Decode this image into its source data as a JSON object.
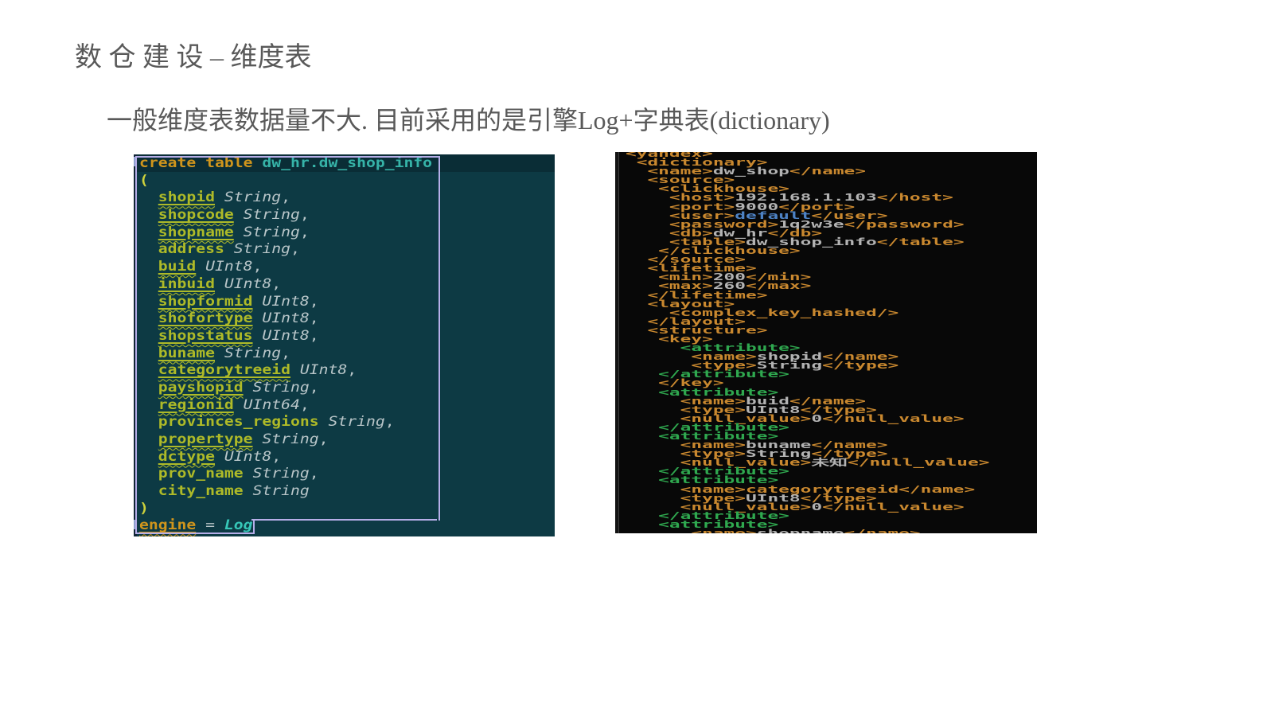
{
  "slide": {
    "title": "数 仓 建 设 – 维度表",
    "subtitle": "一般维度表数据量不大. 目前采用的是引擎Log+字典表(dictionary)"
  },
  "colors": {
    "slide_text": "#595959",
    "left_bg": "#0d3a44",
    "left_line1_bg": "#0a2d36",
    "left_gutter": "#122536",
    "sel": "#b6aee8",
    "kw_orange": "#d0951c",
    "tbl_teal": "#36b3a8",
    "paren_yellow": "#ccd13c",
    "col_green": "#aeba28",
    "type_gray": "#b9c6c9",
    "log_cyan": "#36c7b8",
    "right_bg": "#080808",
    "tag_orange": "#c9882f",
    "attr_green": "#2fa84f",
    "val_gray": "#b3b3b3",
    "user_blue": "#4d82c4",
    "right_gutter_line": "#3c3c3c"
  },
  "left_editor": {
    "lines": [
      [
        [
          "kw",
          "create table "
        ],
        [
          "tbl",
          "dw_hr.dw_shop_info"
        ]
      ],
      [
        [
          "par",
          "("
        ]
      ],
      [
        [
          "pln",
          "  "
        ],
        [
          "colw",
          "shopid"
        ],
        [
          "typ",
          " String"
        ],
        [
          "pln",
          ","
        ]
      ],
      [
        [
          "pln",
          "  "
        ],
        [
          "colw",
          "shopcode"
        ],
        [
          "typ",
          " String"
        ],
        [
          "pln",
          ","
        ]
      ],
      [
        [
          "pln",
          "  "
        ],
        [
          "colw",
          "shopname"
        ],
        [
          "typ",
          " String"
        ],
        [
          "pln",
          ","
        ]
      ],
      [
        [
          "pln",
          "  "
        ],
        [
          "col",
          "address"
        ],
        [
          "typ",
          " String"
        ],
        [
          "pln",
          ","
        ]
      ],
      [
        [
          "pln",
          "  "
        ],
        [
          "colw",
          "buid"
        ],
        [
          "typ",
          " UInt8"
        ],
        [
          "pln",
          ","
        ]
      ],
      [
        [
          "pln",
          "  "
        ],
        [
          "colw",
          "inbuid"
        ],
        [
          "typ",
          " UInt8"
        ],
        [
          "pln",
          ","
        ]
      ],
      [
        [
          "pln",
          "  "
        ],
        [
          "colw",
          "shopformid"
        ],
        [
          "typ",
          " UInt8"
        ],
        [
          "pln",
          ","
        ]
      ],
      [
        [
          "pln",
          "  "
        ],
        [
          "colw",
          "shofortype"
        ],
        [
          "typ",
          " UInt8"
        ],
        [
          "pln",
          ","
        ]
      ],
      [
        [
          "pln",
          "  "
        ],
        [
          "colw",
          "shopstatus"
        ],
        [
          "typ",
          " UInt8"
        ],
        [
          "pln",
          ","
        ]
      ],
      [
        [
          "pln",
          "  "
        ],
        [
          "colw",
          "buname"
        ],
        [
          "typ",
          " String"
        ],
        [
          "pln",
          ","
        ]
      ],
      [
        [
          "pln",
          "  "
        ],
        [
          "colw",
          "categorytreeid"
        ],
        [
          "typ",
          " UInt8"
        ],
        [
          "pln",
          ","
        ]
      ],
      [
        [
          "pln",
          "  "
        ],
        [
          "colw",
          "payshopid"
        ],
        [
          "typ",
          " String"
        ],
        [
          "pln",
          ","
        ]
      ],
      [
        [
          "pln",
          "  "
        ],
        [
          "colw",
          "regionid"
        ],
        [
          "typ",
          " UInt64"
        ],
        [
          "pln",
          ","
        ]
      ],
      [
        [
          "pln",
          "  "
        ],
        [
          "col",
          "provinces_regions"
        ],
        [
          "typ",
          " String"
        ],
        [
          "pln",
          ","
        ]
      ],
      [
        [
          "pln",
          "  "
        ],
        [
          "colw",
          "propertype"
        ],
        [
          "typ",
          " String"
        ],
        [
          "pln",
          ","
        ]
      ],
      [
        [
          "pln",
          "  "
        ],
        [
          "colw",
          "dctype"
        ],
        [
          "typ",
          " UInt8"
        ],
        [
          "pln",
          ","
        ]
      ],
      [
        [
          "pln",
          "  "
        ],
        [
          "col",
          "prov_name"
        ],
        [
          "typ",
          " String"
        ],
        [
          "pln",
          ","
        ]
      ],
      [
        [
          "pln",
          "  "
        ],
        [
          "col",
          "city_name"
        ],
        [
          "typ",
          " String"
        ]
      ],
      [
        [
          "par",
          ")"
        ]
      ],
      [
        [
          "kww",
          "engine"
        ],
        [
          "pln",
          " "
        ],
        [
          "pln",
          "="
        ],
        [
          "pln",
          " "
        ],
        [
          "log",
          "Log"
        ]
      ]
    ]
  },
  "right_editor": {
    "lines": [
      [
        [
          "tag",
          "<yandex>"
        ]
      ],
      [
        [
          "tag",
          " <dictionary>"
        ]
      ],
      [
        [
          "tag",
          "  <name>"
        ],
        [
          "val",
          "dw_shop"
        ],
        [
          "tag",
          "</name>"
        ]
      ],
      [
        [
          "tag",
          "  <source>"
        ]
      ],
      [
        [
          "tag",
          "   <clickhouse>"
        ]
      ],
      [
        [
          "tag",
          "    <host>"
        ],
        [
          "val",
          "192.168.1.103"
        ],
        [
          "tag",
          "</host>"
        ]
      ],
      [
        [
          "tag",
          "    <port>"
        ],
        [
          "val",
          "9000"
        ],
        [
          "tag",
          "</port>"
        ]
      ],
      [
        [
          "tag",
          "    <user>"
        ],
        [
          "blue",
          "default"
        ],
        [
          "tag",
          "</user>"
        ]
      ],
      [
        [
          "tag",
          "    <password>"
        ],
        [
          "val",
          "1q2w3e"
        ],
        [
          "tag",
          "</password>"
        ]
      ],
      [
        [
          "tag",
          "    <db>"
        ],
        [
          "val",
          "dw_hr"
        ],
        [
          "tag",
          "</db>"
        ]
      ],
      [
        [
          "tag",
          "    <table>"
        ],
        [
          "val",
          "dw_shop_info"
        ],
        [
          "tag",
          "</table>"
        ]
      ],
      [
        [
          "tag",
          "   </clickhouse>"
        ]
      ],
      [
        [
          "tag",
          "  </source>"
        ]
      ],
      [
        [
          "tag",
          "  <lifetime>"
        ]
      ],
      [
        [
          "tag",
          "   <min>"
        ],
        [
          "val",
          "200"
        ],
        [
          "tag",
          "</min>"
        ]
      ],
      [
        [
          "tag",
          "   <max>"
        ],
        [
          "val",
          "260"
        ],
        [
          "tag",
          "</max>"
        ]
      ],
      [
        [
          "tag",
          "  </lifetime>"
        ]
      ],
      [
        [
          "tag",
          "  <layout>"
        ]
      ],
      [
        [
          "tag",
          "    <complex_key_hashed/>"
        ]
      ],
      [
        [
          "tag",
          "  </layout>"
        ]
      ],
      [
        [
          "tag",
          "  <structure>"
        ]
      ],
      [
        [
          "tag",
          "   <key>"
        ]
      ],
      [
        [
          "gtag",
          "     <attribute>"
        ]
      ],
      [
        [
          "tag",
          "      <name>"
        ],
        [
          "val",
          "shopid"
        ],
        [
          "tag",
          "</name>"
        ]
      ],
      [
        [
          "tag",
          "      <type>"
        ],
        [
          "val",
          "String"
        ],
        [
          "tag",
          "</type>"
        ]
      ],
      [
        [
          "gtag",
          "   </attribute>"
        ]
      ],
      [
        [
          "tag",
          "   </key>"
        ]
      ],
      [
        [
          "gtag",
          "   <attribute>"
        ]
      ],
      [
        [
          "tag",
          "     <name>"
        ],
        [
          "val",
          "buid"
        ],
        [
          "tag",
          "</name>"
        ]
      ],
      [
        [
          "tag",
          "     <type>"
        ],
        [
          "val",
          "UInt8"
        ],
        [
          "tag",
          "</type>"
        ]
      ],
      [
        [
          "tag",
          "     <null_value>"
        ],
        [
          "val",
          "0"
        ],
        [
          "tag",
          "</null_value>"
        ]
      ],
      [
        [
          "gtag",
          "   </attribute>"
        ]
      ],
      [
        [
          "gtag",
          "   <attribute>"
        ]
      ],
      [
        [
          "tag",
          "     <name>"
        ],
        [
          "val",
          "buname"
        ],
        [
          "tag",
          "</name>"
        ]
      ],
      [
        [
          "tag",
          "     <type>"
        ],
        [
          "val",
          "String"
        ],
        [
          "tag",
          "</type>"
        ]
      ],
      [
        [
          "tag",
          "     <null_value>"
        ],
        [
          "val",
          "未知"
        ],
        [
          "tag",
          "</null_value>"
        ]
      ],
      [
        [
          "gtag",
          "   </attribute>"
        ]
      ],
      [
        [
          "gtag",
          "   <attribute>"
        ]
      ],
      [
        [
          "tag",
          "     <name>categorytreeid</name>"
        ]
      ],
      [
        [
          "tag",
          "     <type>"
        ],
        [
          "val",
          "UInt8"
        ],
        [
          "tag",
          "</type>"
        ]
      ],
      [
        [
          "tag",
          "     <null_value>"
        ],
        [
          "val",
          "0"
        ],
        [
          "tag",
          "</null_value>"
        ]
      ],
      [
        [
          "gtag",
          "   </attribute>"
        ]
      ],
      [
        [
          "gtag",
          "   <attribute>"
        ]
      ],
      [
        [
          "tag",
          "      <name>"
        ],
        [
          "val",
          "shopname"
        ],
        [
          "tag",
          "</name>"
        ]
      ]
    ]
  }
}
